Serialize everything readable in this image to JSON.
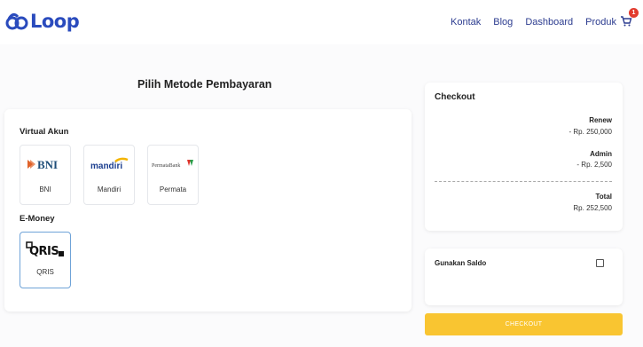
{
  "brand": {
    "name": "Loop",
    "color": "#2a4bbd"
  },
  "nav": {
    "items": [
      "Kontak",
      "Blog",
      "Dashboard",
      "Produk"
    ],
    "cart_count": "1"
  },
  "page": {
    "title": "Pilih Metode Pembayaran"
  },
  "virtual_account": {
    "label": "Virtual Akun",
    "banks": [
      {
        "name": "BNI",
        "logo_text": "BNI",
        "logo_icon": "bni-logo"
      },
      {
        "name": "Mandiri",
        "logo_text": "mandiri",
        "logo_icon": "mandiri-logo"
      },
      {
        "name": "Permata",
        "logo_text": "PermataBank",
        "logo_icon": "permata-logo"
      }
    ]
  },
  "emoney": {
    "label": "E-Money",
    "options": [
      {
        "name": "QRIS",
        "logo_text": "QRIS",
        "logo_icon": "qris-logo",
        "selected": true
      }
    ]
  },
  "checkout": {
    "title": "Checkout",
    "renew_label": "Renew",
    "renew_value": "- Rp. 250,000",
    "admin_label": "Admin",
    "admin_value": "- Rp. 2,500",
    "total_label": "Total",
    "total_value": "Rp. 252,500"
  },
  "saldo": {
    "label": "Gunakan Saldo",
    "checked": false
  },
  "checkout_button": {
    "label": "CHECKOUT",
    "color": "#f9c531"
  },
  "colors": {
    "nav_text": "#2b3b8f",
    "badge": "#e23b2e",
    "selected_border": "#6fa3d8"
  }
}
